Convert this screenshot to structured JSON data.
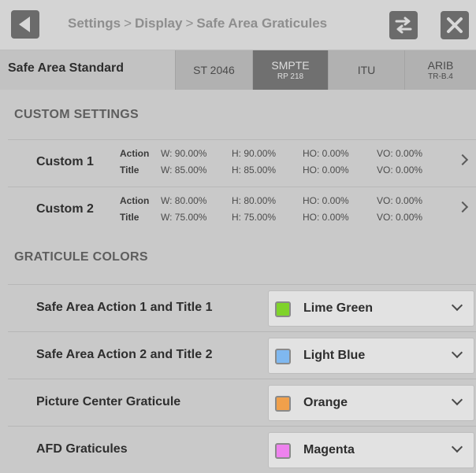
{
  "header": {
    "breadcrumbs": [
      "Settings",
      "Display",
      "Safe Area Graticules"
    ],
    "separator": ">"
  },
  "standard": {
    "label": "Safe Area Standard",
    "options": [
      {
        "label": "ST 2046",
        "sub": ""
      },
      {
        "label": "SMPTE",
        "sub": "RP 218",
        "selected": true
      },
      {
        "label": "ITU",
        "sub": ""
      },
      {
        "label": "ARIB",
        "sub": "TR-B.4"
      }
    ]
  },
  "custom_settings": {
    "header": "CUSTOM SETTINGS",
    "rows": [
      {
        "name": "Custom 1",
        "action": {
          "label": "Action",
          "w": "W: 90.00%",
          "h": "H: 90.00%",
          "ho": "HO: 0.00%",
          "vo": "VO: 0.00%"
        },
        "title": {
          "label": "Title",
          "w": "W: 85.00%",
          "h": "H: 85.00%",
          "ho": "HO: 0.00%",
          "vo": "VO: 0.00%"
        }
      },
      {
        "name": "Custom 2",
        "action": {
          "label": "Action",
          "w": "W: 80.00%",
          "h": "H: 80.00%",
          "ho": "HO: 0.00%",
          "vo": "VO: 0.00%"
        },
        "title": {
          "label": "Title",
          "w": "W: 75.00%",
          "h": "H: 75.00%",
          "ho": "HO: 0.00%",
          "vo": "VO: 0.00%"
        }
      }
    ]
  },
  "graticule_colors": {
    "header": "GRATICULE COLORS",
    "rows": [
      {
        "label": "Safe Area Action 1 and Title 1",
        "value": "Lime Green",
        "swatch": "#7fd32a"
      },
      {
        "label": "Safe Area Action 2 and Title 2",
        "value": "Light Blue",
        "swatch": "#7fb8f0"
      },
      {
        "label": "Picture Center Graticule",
        "value": "Orange",
        "swatch": "#f0a04b"
      },
      {
        "label": "AFD Graticules",
        "value": "Magenta",
        "swatch": "#ee82ee"
      }
    ]
  },
  "icons": {
    "back": "back-arrow-icon",
    "swap": "swap-arrows-icon",
    "close": "close-icon"
  }
}
